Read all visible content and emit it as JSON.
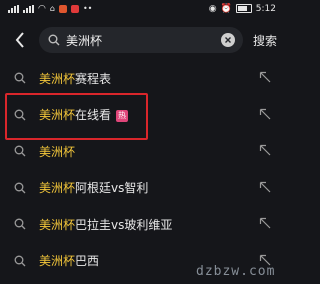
{
  "status_bar": {
    "time": "5:12",
    "app_icon_colors": [
      "#e0562e",
      "#e03a3a"
    ]
  },
  "search": {
    "query": "美洲杯",
    "button_label": "搜索"
  },
  "suggestions": [
    {
      "keyword": "美洲杯",
      "rest": "赛程表",
      "hot": false
    },
    {
      "keyword": "美洲杯",
      "rest": "在线看",
      "hot": true,
      "hot_label": "热"
    },
    {
      "keyword": "美洲杯",
      "rest": "",
      "hot": false
    },
    {
      "keyword": "美洲杯",
      "rest": "阿根廷vs智利",
      "hot": false
    },
    {
      "keyword": "美洲杯",
      "rest": "巴拉圭vs玻利维亚",
      "hot": false
    },
    {
      "keyword": "美洲杯",
      "rest": "巴西",
      "hot": false
    }
  ],
  "colors": {
    "keyword_highlight": "#f3c63a",
    "hot_badge": "#e0467a",
    "annotation_box": "#d9262b"
  },
  "watermark": "dzbzw.com"
}
